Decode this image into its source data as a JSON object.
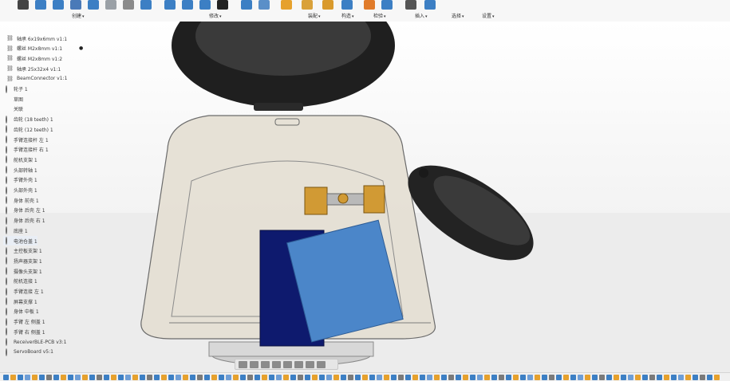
{
  "toolbar": {
    "groups": [
      {
        "label": "创建",
        "caret": "▾"
      },
      {
        "label": "修改",
        "caret": "▾"
      },
      {
        "label": "装配",
        "caret": "▾"
      },
      {
        "label": "构造",
        "caret": "▾"
      },
      {
        "label": "检验",
        "caret": "▾"
      },
      {
        "label": "插入",
        "caret": "▾"
      },
      {
        "label": "选择",
        "caret": "▾"
      },
      {
        "label": "设置",
        "caret": "▾"
      }
    ],
    "icons": [
      {
        "name": "sketch-icon",
        "color": "#444444"
      },
      {
        "name": "extrude-icon",
        "color": "#3c7fc4"
      },
      {
        "name": "revolve-icon",
        "color": "#3c7fc4"
      },
      {
        "name": "hole-icon",
        "color": "#4a7ab8"
      },
      {
        "name": "box-icon",
        "color": "#3c7fc4"
      },
      {
        "name": "fillet-icon",
        "color": "#9aa0a6"
      },
      {
        "name": "draft-icon",
        "color": "#8a8a8a"
      },
      {
        "name": "shell-icon",
        "color": "#3c7fc4"
      },
      {
        "name": "press-pull-icon",
        "color": "#3c7fc4"
      },
      {
        "name": "split-icon",
        "color": "#3c7fc4"
      },
      {
        "name": "scale-icon",
        "color": "#3c7fc4"
      },
      {
        "name": "move-icon",
        "color": "#222222"
      },
      {
        "name": "joint-icon",
        "color": "#3c7fc4"
      },
      {
        "name": "rigid-group-icon",
        "color": "#5a8fc8"
      },
      {
        "name": "offset-plane-icon",
        "color": "#e6a12d"
      },
      {
        "name": "axis-icon",
        "color": "#d9a13a"
      },
      {
        "name": "measure-icon",
        "color": "#d99a2d"
      },
      {
        "name": "interference-icon",
        "color": "#3c7fc4"
      },
      {
        "name": "insert-derive-icon",
        "color": "#e07b2a"
      },
      {
        "name": "insert-mesh-icon",
        "color": "#3c7fc4"
      },
      {
        "name": "select-icon",
        "color": "#555555"
      },
      {
        "name": "preferences-icon",
        "color": "#3c7fc4"
      }
    ]
  },
  "browser": {
    "pin_icon": "pin-icon",
    "items": [
      {
        "icon": "link-icon",
        "label": "轴承 6x19x6mm v1:1"
      },
      {
        "icon": "link-icon",
        "label": "螺丝 M2x8mm v1:1"
      },
      {
        "icon": "link-icon",
        "label": "螺丝 M2x8mm v1:2"
      },
      {
        "icon": "link-icon",
        "label": "轴承 25x32x4 v1:1"
      },
      {
        "icon": "link-icon",
        "label": "BeamConnector v1:1"
      },
      {
        "icon": "ring-icon",
        "label": "轮子 1"
      },
      {
        "icon": "folder-icon",
        "label": "草图"
      },
      {
        "icon": "folder-icon",
        "label": "关联"
      },
      {
        "icon": "ring-icon",
        "label": "齿轮 (18 teeth) 1"
      },
      {
        "icon": "ring-icon",
        "label": "齿轮 (12 teeth) 1"
      },
      {
        "icon": "ring-icon",
        "label": "手臂连接杆 左 1"
      },
      {
        "icon": "ring-icon",
        "label": "手臂连接杆 右 1"
      },
      {
        "icon": "ring-icon",
        "label": "舵机支架 1"
      },
      {
        "icon": "ring-icon",
        "label": "头部转轴 1"
      },
      {
        "icon": "ring-icon",
        "label": "手臂外壳 1"
      },
      {
        "icon": "ring-icon",
        "label": "头部外壳 1"
      },
      {
        "icon": "ring-icon",
        "label": "身体 前壳 1"
      },
      {
        "icon": "ring-icon",
        "label": "身体 后壳 左 1"
      },
      {
        "icon": "ring-icon",
        "label": "身体 后壳 右 1"
      },
      {
        "icon": "ring-icon",
        "label": "底座 1"
      },
      {
        "icon": "ring-icon",
        "label": "电池仓盖 1",
        "selected": true
      },
      {
        "icon": "ring-icon",
        "label": "主控板支架 1"
      },
      {
        "icon": "ring-icon",
        "label": "扬声器支架 1"
      },
      {
        "icon": "ring-icon",
        "label": "摄像头支架 1"
      },
      {
        "icon": "ring-icon",
        "label": "舵机连接 1"
      },
      {
        "icon": "ring-icon",
        "label": "手臂连接 左 1"
      },
      {
        "icon": "ring-icon",
        "label": "屏幕支撑 1"
      },
      {
        "icon": "ring-icon",
        "label": "身体 中板 1"
      },
      {
        "icon": "ring-icon",
        "label": "手臂 左 侧盖 1"
      },
      {
        "icon": "ring-icon",
        "label": "手臂 右 侧盖 1"
      },
      {
        "icon": "ring-icon",
        "label": "ReceiverBLE-PCB v3:1"
      },
      {
        "icon": "ring-icon",
        "label": "ServoBoard v5:1"
      }
    ]
  },
  "model": {
    "shell_color": "#e4ded2",
    "head_color": "#1f1f1f",
    "arm_color": "#232323",
    "battery_color": "#0e1a6e",
    "board_color": "#4b86c9",
    "gear_color": "#d19a34"
  },
  "navbar": {
    "icons": [
      "orbit-icon",
      "pan-icon",
      "look-at-icon",
      "zoom-icon",
      "fit-icon",
      "display-settings-icon",
      "grid-icon",
      "viewports-icon"
    ]
  },
  "timeline": {
    "colors": [
      "#3c7fc4",
      "#e6a12d",
      "#3c7fc4",
      "#6e9ed6",
      "#e6a12d",
      "#3c7fc4",
      "#7a7a7a"
    ]
  }
}
